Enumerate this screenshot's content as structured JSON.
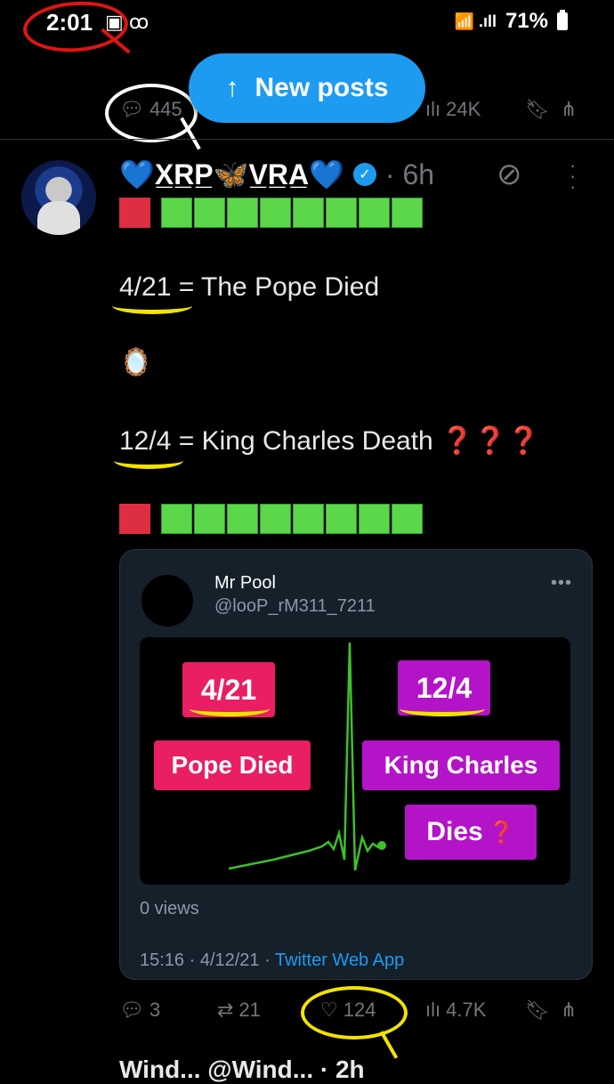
{
  "status_bar": {
    "time": "2:01",
    "left_icons": "▣ ꝏ",
    "signal": "📶 .ıll",
    "battery": "71%"
  },
  "top_actions": {
    "replies": "445",
    "views": "24K"
  },
  "new_posts": {
    "arrow": "↑",
    "label": "New posts"
  },
  "post": {
    "author_display": "💙X̲R̲P̲🦋V̲R̲A̲💙",
    "age": "· 6h",
    "line1_prefix": "4/21",
    "line1_suffix": " = The Pope Died",
    "mirror": "🪞",
    "line2_prefix": "12/4",
    "line2_suffix": " = King Charles Death ",
    "line2_marks": "❓❓❓",
    "squares": {
      "red": 1,
      "green": 8
    }
  },
  "quoted": {
    "name": "Mr Pool",
    "handle": "@looP_rM311_7211",
    "more": "•••",
    "image": {
      "date_left": "4/21",
      "date_right": "12/4",
      "label_left": "Pope Died",
      "label_right_1": "King Charles",
      "label_right_2": "Dies",
      "label_right_mark": "❓"
    },
    "views": "0 views",
    "time": "15:16 · 4/12/21 · ",
    "app": "Twitter Web App"
  },
  "post_actions": {
    "replies": "3",
    "reposts": "21",
    "likes": "124",
    "views": "4.7K"
  },
  "next_post_peek": "Wind... @Wind... · 2h",
  "colors": {
    "accent": "#1d9bf0",
    "red_annotation": "#e01414",
    "yellow_annotation": "#f2e300",
    "white_annotation": "#ffffff"
  }
}
